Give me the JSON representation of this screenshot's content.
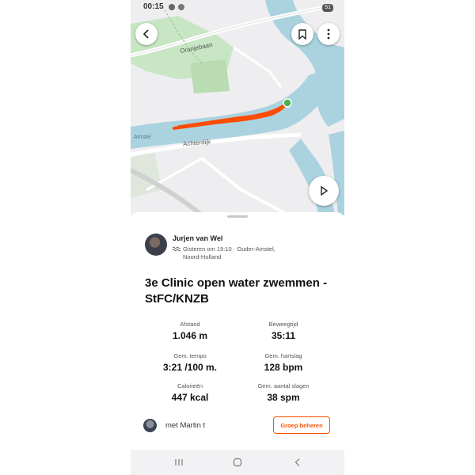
{
  "status_bar": {
    "time": "00:15",
    "battery": "51"
  },
  "map": {
    "labels": {
      "road_north": "Oranjebaan",
      "road_south": "Achterdijk",
      "road_west": "Amstel"
    },
    "colors": {
      "water": "#aad3df",
      "park": "#c8e6c4",
      "route": "#fc4c02",
      "start_marker": "#4caf50",
      "land": "#eeeef0"
    },
    "icons": {
      "back": "chevron-left-icon",
      "save": "bookmark-icon",
      "more": "more-vertical-icon",
      "play": "play-icon"
    }
  },
  "activity": {
    "athlete_name": "Jurjen van Wel",
    "sport_icon": "swim-icon",
    "meta_line1": "Gisteren om 19:10 · Ouder-Amstel,",
    "meta_line2": "Noord-Holland",
    "title": "3e Clinic open water zwemmen - StFC/KNZB",
    "stats": [
      {
        "label": "Afstand",
        "value": "1.046 m"
      },
      {
        "label": "Beweegtijd",
        "value": "35:11"
      },
      {
        "label": "Gem. tempo",
        "value": "3:21 /100 m."
      },
      {
        "label": "Gem. hartslag",
        "value": "128 bpm"
      },
      {
        "label": "Calorieën",
        "value": "447 kcal"
      },
      {
        "label": "Gem. aantal slagen",
        "value": "38 spm"
      }
    ],
    "with_label": "met Martin t",
    "group_button": "Groep beheren",
    "accent_color": "#fc5200"
  },
  "navbar": {
    "icons": [
      "recent-apps-icon",
      "home-icon",
      "back-icon"
    ]
  }
}
